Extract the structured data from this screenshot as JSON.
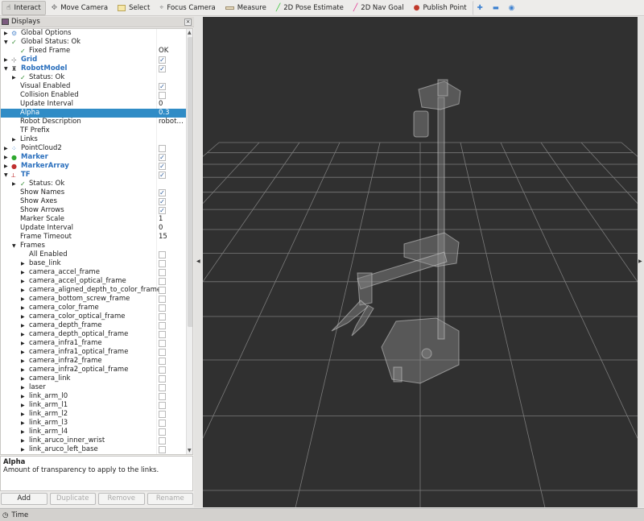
{
  "toolbar": {
    "items": [
      {
        "label": "Interact",
        "icon": "hand-pointer-icon",
        "active": true
      },
      {
        "label": "Move Camera",
        "icon": "move-camera-icon"
      },
      {
        "label": "Select",
        "icon": "select-box-icon"
      },
      {
        "label": "Focus Camera",
        "icon": "focus-camera-icon"
      },
      {
        "label": "Measure",
        "icon": "ruler-icon"
      },
      {
        "label": "2D Pose Estimate",
        "icon": "green-arrow-icon"
      },
      {
        "label": "2D Nav Goal",
        "icon": "pink-arrow-icon"
      },
      {
        "label": "Publish Point",
        "icon": "map-pin-icon"
      }
    ]
  },
  "displays": {
    "title": "Displays",
    "rows": [
      {
        "label": "Global Options",
        "lvl": 0,
        "exp": "r",
        "icon": "gear"
      },
      {
        "label": "Global Status: Ok",
        "lvl": 0,
        "exp": "d",
        "icon": "check"
      },
      {
        "label": "Fixed Frame",
        "lvl": 1,
        "icon": "check",
        "value": "OK"
      },
      {
        "label": "Grid",
        "lvl": 0,
        "exp": "r",
        "icon": "grid",
        "blue": true,
        "cb": true
      },
      {
        "label": "RobotModel",
        "lvl": 0,
        "exp": "d",
        "icon": "robot",
        "blue": true,
        "cb": true
      },
      {
        "label": "Status: Ok",
        "lvl": 1,
        "exp": "r",
        "icon": "check"
      },
      {
        "label": "Visual Enabled",
        "lvl": 1,
        "cb": true
      },
      {
        "label": "Collision Enabled",
        "lvl": 1,
        "cb": false
      },
      {
        "label": "Update Interval",
        "lvl": 1,
        "value": "0"
      },
      {
        "label": "Alpha",
        "lvl": 1,
        "value": "0.3",
        "sel": true
      },
      {
        "label": "Robot Description",
        "lvl": 1,
        "value": "robot…"
      },
      {
        "label": "TF Prefix",
        "lvl": 1
      },
      {
        "label": "Links",
        "lvl": 1,
        "exp": "r"
      },
      {
        "label": "PointCloud2",
        "lvl": 0,
        "exp": "r",
        "icon": "points",
        "cb": false
      },
      {
        "label": "Marker",
        "lvl": 0,
        "exp": "r",
        "icon": "marker",
        "blue": true,
        "cb": true
      },
      {
        "label": "MarkerArray",
        "lvl": 0,
        "exp": "r",
        "icon": "markerarray",
        "blue": true,
        "cb": true
      },
      {
        "label": "TF",
        "lvl": 0,
        "exp": "d",
        "icon": "axes",
        "blue": true,
        "cb": true
      },
      {
        "label": "Status: Ok",
        "lvl": 1,
        "exp": "r",
        "icon": "check"
      },
      {
        "label": "Show Names",
        "lvl": 1,
        "cb": true
      },
      {
        "label": "Show Axes",
        "lvl": 1,
        "cb": true
      },
      {
        "label": "Show Arrows",
        "lvl": 1,
        "cb": true
      },
      {
        "label": "Marker Scale",
        "lvl": 1,
        "value": "1"
      },
      {
        "label": "Update Interval",
        "lvl": 1,
        "value": "0"
      },
      {
        "label": "Frame Timeout",
        "lvl": 1,
        "value": "15"
      },
      {
        "label": "Frames",
        "lvl": 1,
        "exp": "d"
      },
      {
        "label": "All Enabled",
        "lvl": 2,
        "cb": false
      },
      {
        "label": "base_link",
        "lvl": 2,
        "exp": "r",
        "cb": false
      },
      {
        "label": "camera_accel_frame",
        "lvl": 2,
        "exp": "r",
        "cb": false
      },
      {
        "label": "camera_accel_optical_frame",
        "lvl": 2,
        "exp": "r",
        "cb": false
      },
      {
        "label": "camera_aligned_depth_to_color_frame",
        "lvl": 2,
        "exp": "r",
        "cb": false
      },
      {
        "label": "camera_bottom_screw_frame",
        "lvl": 2,
        "exp": "r",
        "cb": false
      },
      {
        "label": "camera_color_frame",
        "lvl": 2,
        "exp": "r",
        "cb": false
      },
      {
        "label": "camera_color_optical_frame",
        "lvl": 2,
        "exp": "r",
        "cb": false
      },
      {
        "label": "camera_depth_frame",
        "lvl": 2,
        "exp": "r",
        "cb": false
      },
      {
        "label": "camera_depth_optical_frame",
        "lvl": 2,
        "exp": "r",
        "cb": false
      },
      {
        "label": "camera_infra1_frame",
        "lvl": 2,
        "exp": "r",
        "cb": false
      },
      {
        "label": "camera_infra1_optical_frame",
        "lvl": 2,
        "exp": "r",
        "cb": false
      },
      {
        "label": "camera_infra2_frame",
        "lvl": 2,
        "exp": "r",
        "cb": false
      },
      {
        "label": "camera_infra2_optical_frame",
        "lvl": 2,
        "exp": "r",
        "cb": false
      },
      {
        "label": "camera_link",
        "lvl": 2,
        "exp": "r",
        "cb": false
      },
      {
        "label": "laser",
        "lvl": 2,
        "exp": "r",
        "cb": false
      },
      {
        "label": "link_arm_l0",
        "lvl": 2,
        "exp": "r",
        "cb": false
      },
      {
        "label": "link_arm_l1",
        "lvl": 2,
        "exp": "r",
        "cb": false
      },
      {
        "label": "link_arm_l2",
        "lvl": 2,
        "exp": "r",
        "cb": false
      },
      {
        "label": "link_arm_l3",
        "lvl": 2,
        "exp": "r",
        "cb": false
      },
      {
        "label": "link_arm_l4",
        "lvl": 2,
        "exp": "r",
        "cb": false
      },
      {
        "label": "link_aruco_inner_wrist",
        "lvl": 2,
        "exp": "r",
        "cb": false
      },
      {
        "label": "link_aruco_left_base",
        "lvl": 2,
        "exp": "r",
        "cb": false
      }
    ],
    "description": {
      "title": "Alpha",
      "text": "Amount of transparency to apply to the links."
    },
    "buttons": {
      "add": "Add",
      "duplicate": "Duplicate",
      "remove": "Remove",
      "rename": "Rename"
    }
  },
  "time_panel": {
    "title": "Time"
  },
  "colors": {
    "selection": "#308cc6",
    "display_name": "#2a6fbd",
    "viewport": "#303030"
  }
}
